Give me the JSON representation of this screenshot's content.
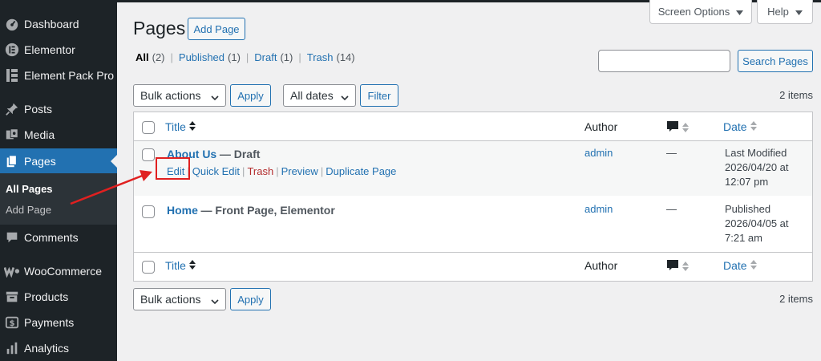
{
  "sidebar": {
    "items": [
      {
        "label": "Dashboard",
        "icon": "dashboard-icon"
      },
      {
        "label": "Elementor",
        "icon": "elementor-icon"
      },
      {
        "label": "Element Pack Pro",
        "icon": "element-pack-icon"
      },
      {
        "label": "Posts",
        "icon": "pin-icon"
      },
      {
        "label": "Media",
        "icon": "media-icon"
      },
      {
        "label": "Pages",
        "icon": "pages-icon"
      },
      {
        "label": "Comments",
        "icon": "comment-icon"
      },
      {
        "label": "WooCommerce",
        "icon": "woocommerce-icon"
      },
      {
        "label": "Products",
        "icon": "products-icon"
      },
      {
        "label": "Payments",
        "icon": "payments-icon"
      },
      {
        "label": "Analytics",
        "icon": "analytics-icon"
      }
    ],
    "submenu": [
      "All Pages",
      "Add Page"
    ]
  },
  "screen_options": {
    "label": "Screen Options"
  },
  "help": {
    "label": "Help"
  },
  "header": {
    "title": "Pages",
    "add_button": "Add Page"
  },
  "filters": {
    "all": "All",
    "all_count": "(2)",
    "published": "Published",
    "published_count": "(1)",
    "draft": "Draft",
    "draft_count": "(1)",
    "trash": "Trash",
    "trash_count": "(14)"
  },
  "search": {
    "button": "Search Pages",
    "value": ""
  },
  "toolbar": {
    "bulk_actions": "Bulk actions",
    "apply": "Apply",
    "dates": "All dates",
    "filter": "Filter",
    "items_count": "2 items"
  },
  "table": {
    "columns": {
      "title": "Title",
      "author": "Author",
      "date": "Date"
    },
    "rows": [
      {
        "title": "About Us",
        "state": "— Draft",
        "author": "admin",
        "comments": "—",
        "date_status": "Last Modified",
        "date_value": "2026/04/20 at",
        "date_time": "12:07 pm",
        "actions": [
          "Edit",
          "Quick Edit",
          "Trash",
          "Preview",
          "Duplicate Page"
        ]
      },
      {
        "title": "Home",
        "state": "— Front Page, Elementor",
        "author": "admin",
        "comments": "—",
        "date_status": "Published",
        "date_value": "2026/04/05 at",
        "date_time": "7:21 am"
      }
    ]
  },
  "colors": {
    "accent": "#2271b1",
    "sidebar_bg": "#1d2327",
    "highlight": "#e02020"
  }
}
